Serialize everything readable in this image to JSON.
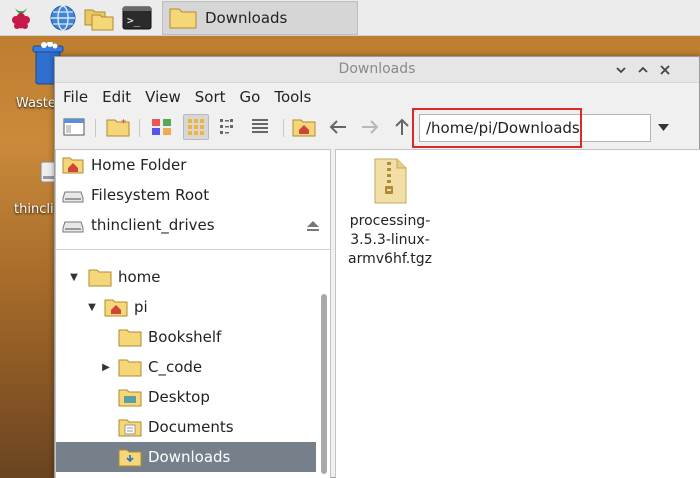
{
  "taskbar": {
    "active_task_label": "Downloads"
  },
  "desktop": {
    "wastebasket_label": "Waste",
    "drive_label": "thincli"
  },
  "window": {
    "title": "Downloads"
  },
  "menubar": {
    "items": [
      "File",
      "Edit",
      "View",
      "Sort",
      "Go",
      "Tools"
    ]
  },
  "toolbar": {
    "path": "/home/pi/Downloads"
  },
  "places": [
    {
      "label": "Home Folder",
      "icon": "home-folder-icon"
    },
    {
      "label": "Filesystem Root",
      "icon": "drive-icon"
    },
    {
      "label": "thinclient_drives",
      "icon": "drive-icon"
    }
  ],
  "tree": [
    {
      "label": "home",
      "expander": "▼"
    },
    {
      "label": "pi",
      "expander": "▼"
    },
    {
      "label": "Bookshelf",
      "expander": ""
    },
    {
      "label": "C_code",
      "expander": "▶"
    },
    {
      "label": "Desktop",
      "expander": ""
    },
    {
      "label": "Documents",
      "expander": ""
    },
    {
      "label": "Downloads",
      "expander": ""
    }
  ],
  "files": [
    {
      "name": "processing-3.5.3-linux-armv6hf.tgz",
      "lines": [
        "processing-",
        "3.5.3-linux-",
        "armv6hf.tgz"
      ]
    }
  ],
  "colors": {
    "selection": "#75808a",
    "highlight_box": "#e02828",
    "folder": "#f5d77a"
  }
}
